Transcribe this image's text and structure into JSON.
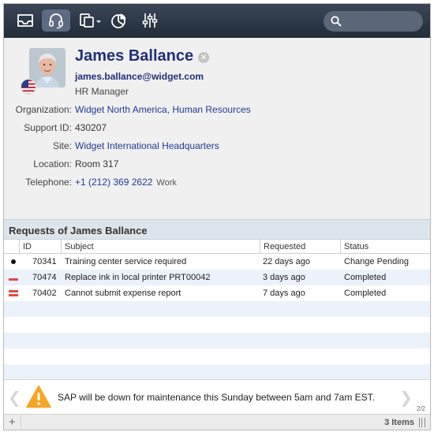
{
  "toolbar": {
    "buttons": [
      {
        "icon": "inbox-icon"
      },
      {
        "icon": "headset-icon",
        "active": true
      },
      {
        "icon": "documents-icon"
      },
      {
        "icon": "pie-chart-icon"
      },
      {
        "icon": "sliders-icon"
      }
    ],
    "search_placeholder": ""
  },
  "profile": {
    "name": "James Ballance",
    "email": "james.ballance@widget.com",
    "role": "HR Manager",
    "fields": {
      "organization_label": "Organization:",
      "organization_value": "Widget North America, Human Resources",
      "support_id_label": "Support ID:",
      "support_id_value": "430207",
      "site_label": "Site:",
      "site_value": "Widget International Headquarters",
      "location_label": "Location:",
      "location_value": "Room 317",
      "telephone_label": "Telephone:",
      "telephone_value": "+1 (212) 369 2622",
      "telephone_type": "Work"
    }
  },
  "requests": {
    "title": "Requests of James Ballance",
    "columns": {
      "id": "ID",
      "subject": "Subject",
      "requested": "Requested",
      "status": "Status"
    },
    "rows": [
      {
        "priority": "low",
        "id": "70341",
        "subject": "Training center service required",
        "requested": "22 days ago",
        "status": "Change Pending"
      },
      {
        "priority": "medium",
        "id": "70474",
        "subject": "Replace ink in local printer PRT00042",
        "requested": "3 days ago",
        "status": "Completed"
      },
      {
        "priority": "high",
        "id": "70402",
        "subject": "Cannot submit expense report",
        "requested": "7 days ago",
        "status": "Completed"
      }
    ]
  },
  "notification": {
    "text": "SAP will be down for maintenance this Sunday between 5am and 7am EST.",
    "page": "2/2",
    "prev": "❮",
    "next": "❯"
  },
  "footer": {
    "add_label": "+",
    "count": "3 Items"
  },
  "colors": {
    "toolbar_top": "#3a4657",
    "toolbar_bottom": "#222c3a",
    "link": "#1f3a96",
    "name": "#1f2f78",
    "priority_high": "#e04848",
    "warning": "#f5a623"
  }
}
